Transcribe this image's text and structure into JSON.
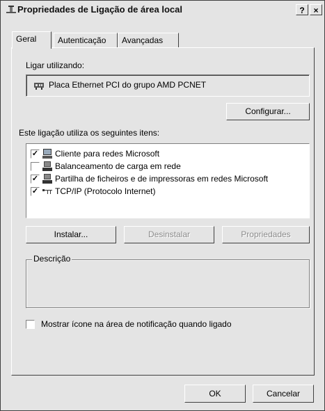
{
  "window": {
    "title": "Propriedades de Ligação de área local",
    "help_label": "?",
    "close_label": "×"
  },
  "tabs": [
    {
      "label": "Geral"
    },
    {
      "label": "Autenticação"
    },
    {
      "label": "Avançadas"
    }
  ],
  "general": {
    "connect_using_label": "Ligar utilizando:",
    "adapter_name": "Placa Ethernet PCI do grupo AMD PCNET",
    "configure_button": "Configurar...",
    "items_label": "Este ligação utiliza os seguintes itens:",
    "items": [
      {
        "label": "Cliente para redes Microsoft",
        "checked": true,
        "icon": "network-client-icon"
      },
      {
        "label": "Balanceamento de carga em rede",
        "checked": false,
        "icon": "network-service-icon"
      },
      {
        "label": "Partilha de ficheiros e de impressoras em redes Microsoft",
        "checked": true,
        "icon": "network-service-icon"
      },
      {
        "label": "TCP/IP (Protocolo Internet)",
        "checked": true,
        "icon": "protocol-icon"
      }
    ],
    "install_button": "Instalar...",
    "uninstall_button": "Desinstalar",
    "properties_button": "Propriedades",
    "description_label": "Descrição",
    "description_text": "",
    "show_icon_label": "Mostrar ícone na área de notificação quando ligado",
    "show_icon_checked": false
  },
  "footer": {
    "ok_button": "OK",
    "cancel_button": "Cancelar"
  }
}
